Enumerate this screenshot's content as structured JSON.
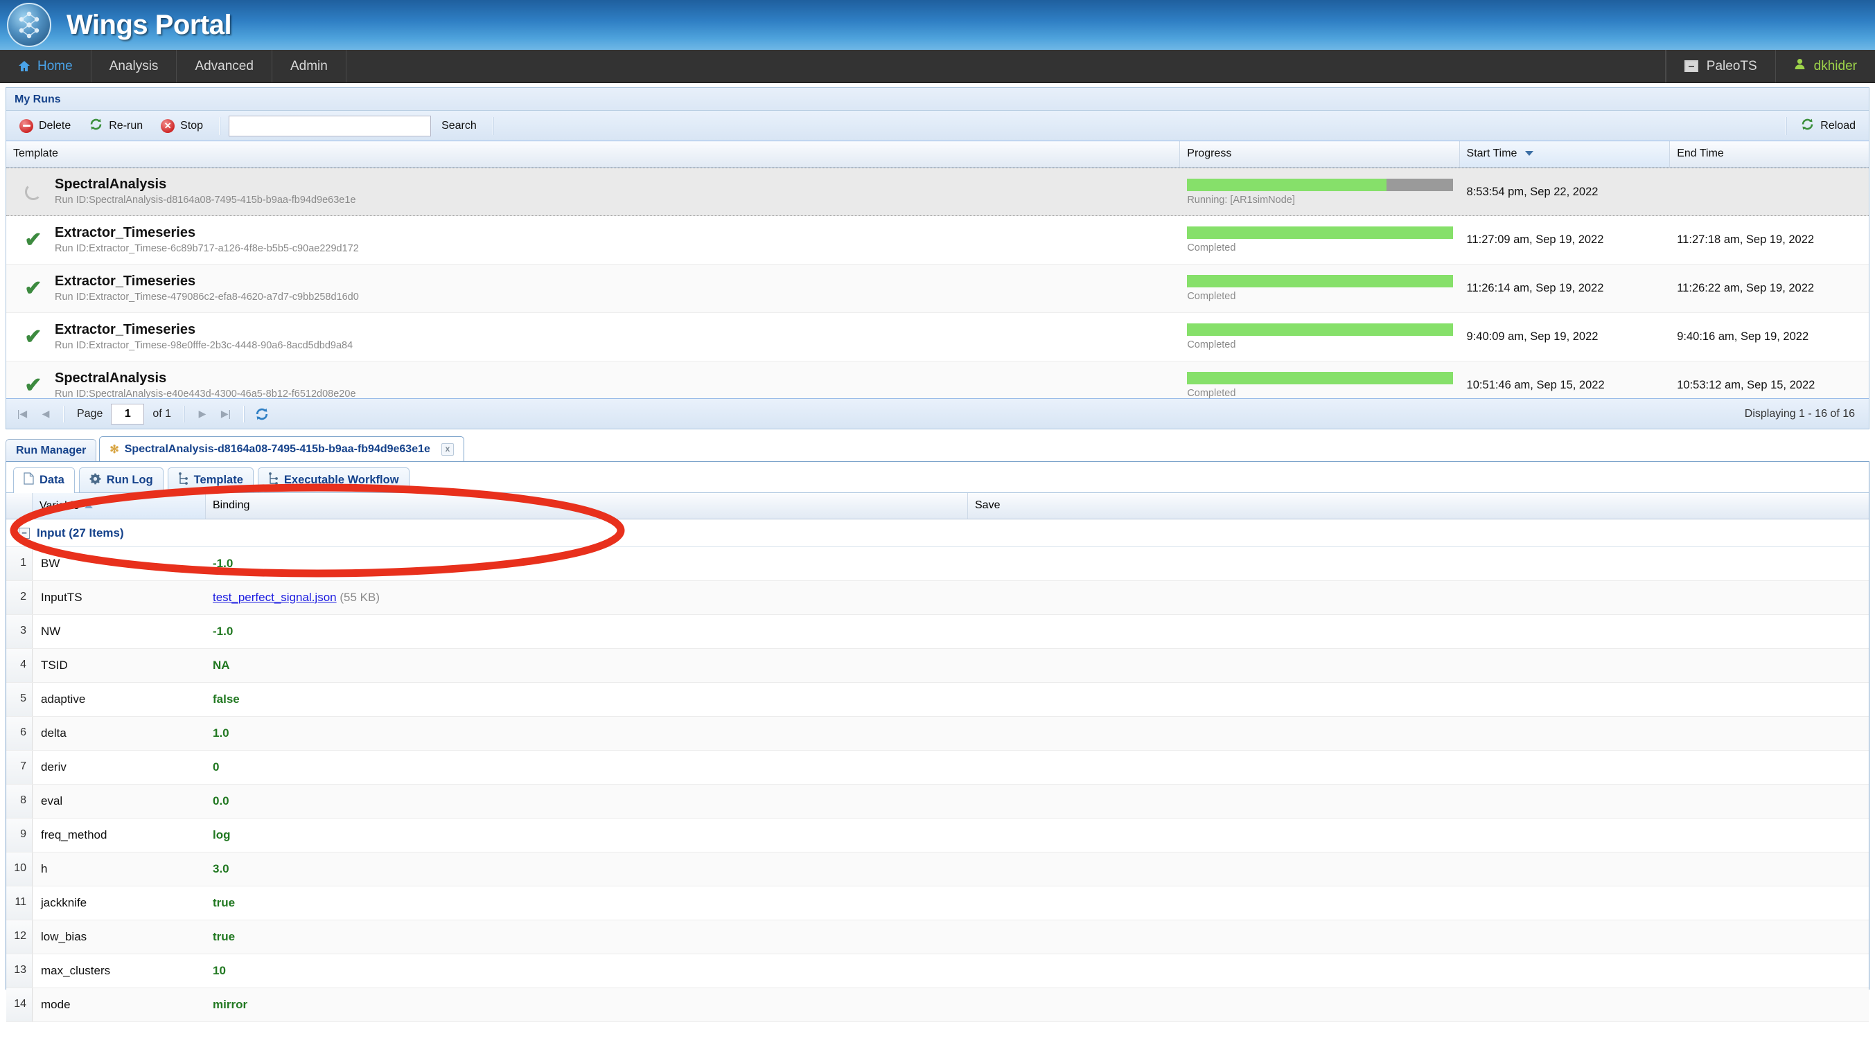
{
  "header": {
    "title": "Wings Portal",
    "logo_icon": "wings-logo-icon"
  },
  "nav": {
    "items": [
      {
        "label": "Home",
        "icon": "home-icon",
        "active": true
      },
      {
        "label": "Analysis",
        "active": false
      },
      {
        "label": "Advanced",
        "active": false
      },
      {
        "label": "Admin",
        "active": false
      }
    ],
    "right": [
      {
        "label": "PaleoTS",
        "icon": "domain-box-icon"
      },
      {
        "label": "dkhider",
        "icon": "user-icon"
      }
    ]
  },
  "my_runs": {
    "panel_title": "My Runs",
    "toolbar": {
      "delete_label": "Delete",
      "rerun_label": "Re-run",
      "stop_label": "Stop",
      "search_value": "",
      "search_placeholder": "",
      "search_label": "Search",
      "reload_label": "Reload"
    },
    "columns": [
      "Template",
      "Progress",
      "Start Time",
      "End Time"
    ],
    "sorted_column": "Start Time",
    "sort_direction": "desc",
    "rows": [
      {
        "template": "SpectralAnalysis",
        "run_id": "Run ID:SpectralAnalysis-d8164a08-7495-415b-b9aa-fb94d9e63e1e",
        "status_icon": "running-spinner-icon",
        "progress_percent": 75,
        "progress_text": "Running: [AR1simNode]",
        "start_time": "8:53:54 pm, Sep 22, 2022",
        "end_time": "",
        "selected": true
      },
      {
        "template": "Extractor_Timeseries",
        "run_id": "Run ID:Extractor_Timese-6c89b717-a126-4f8e-b5b5-c90ae229d172",
        "status_icon": "check-icon",
        "progress_percent": 100,
        "progress_text": "Completed",
        "start_time": "11:27:09 am, Sep 19, 2022",
        "end_time": "11:27:18 am, Sep 19, 2022",
        "selected": false
      },
      {
        "template": "Extractor_Timeseries",
        "run_id": "Run ID:Extractor_Timese-479086c2-efa8-4620-a7d7-c9bb258d16d0",
        "status_icon": "check-icon",
        "progress_percent": 100,
        "progress_text": "Completed",
        "start_time": "11:26:14 am, Sep 19, 2022",
        "end_time": "11:26:22 am, Sep 19, 2022",
        "selected": false
      },
      {
        "template": "Extractor_Timeseries",
        "run_id": "Run ID:Extractor_Timese-98e0fffe-2b3c-4448-90a6-8acd5dbd9a84",
        "status_icon": "check-icon",
        "progress_percent": 100,
        "progress_text": "Completed",
        "start_time": "9:40:09 am, Sep 19, 2022",
        "end_time": "9:40:16 am, Sep 19, 2022",
        "selected": false
      },
      {
        "template": "SpectralAnalysis",
        "run_id": "Run ID:SpectralAnalysis-e40e443d-4300-46a5-8b12-f6512d08e20e",
        "status_icon": "check-icon",
        "progress_percent": 100,
        "progress_text": "Completed",
        "start_time": "10:51:46 am, Sep 15, 2022",
        "end_time": "10:53:12 am, Sep 15, 2022",
        "selected": false
      }
    ],
    "paging": {
      "first_icon": "first-page-icon",
      "prev_icon": "prev-page-icon",
      "page_label": "Page",
      "page_value": "1",
      "of_label": "of 1",
      "next_icon": "next-page-icon",
      "last_icon": "last-page-icon",
      "refresh_icon": "refresh-icon",
      "display_text": "Displaying 1 - 16 of 16"
    }
  },
  "tabs": {
    "items": [
      {
        "label": "Run Manager",
        "active": false,
        "closable": false
      },
      {
        "label": "SpectralAnalysis-d8164a08-7495-415b-b9aa-fb94d9e63e1e",
        "active": true,
        "closable": true,
        "icon": "star-icon"
      }
    ],
    "close_label": "x"
  },
  "subtabs": {
    "items": [
      {
        "label": "Data",
        "icon": "document-icon",
        "active": true
      },
      {
        "label": "Run Log",
        "icon": "gear-icon",
        "active": false
      },
      {
        "label": "Template",
        "icon": "workflow-icon",
        "active": false
      },
      {
        "label": "Executable Workflow",
        "icon": "workflow-icon",
        "active": false
      }
    ]
  },
  "data_grid": {
    "columns": [
      "Variable",
      "Binding",
      "Save"
    ],
    "sorted_column": "Variable",
    "sort_direction": "asc",
    "group_label": "Input (27 Items)",
    "group_collapsed": false,
    "rows": [
      {
        "num": "1",
        "variable": "BW",
        "binding": "-1.0",
        "type": "value"
      },
      {
        "num": "2",
        "variable": "InputTS",
        "binding": "test_perfect_signal.json",
        "size": "(55 KB)",
        "type": "file"
      },
      {
        "num": "3",
        "variable": "NW",
        "binding": "-1.0",
        "type": "value"
      },
      {
        "num": "4",
        "variable": "TSID",
        "binding": "NA",
        "type": "value"
      },
      {
        "num": "5",
        "variable": "adaptive",
        "binding": "false",
        "type": "value"
      },
      {
        "num": "6",
        "variable": "delta",
        "binding": "1.0",
        "type": "value"
      },
      {
        "num": "7",
        "variable": "deriv",
        "binding": "0",
        "type": "value"
      },
      {
        "num": "8",
        "variable": "eval",
        "binding": "0.0",
        "type": "value"
      },
      {
        "num": "9",
        "variable": "freq_method",
        "binding": "log",
        "type": "value"
      },
      {
        "num": "10",
        "variable": "h",
        "binding": "3.0",
        "type": "value"
      },
      {
        "num": "11",
        "variable": "jackknife",
        "binding": "true",
        "type": "value"
      },
      {
        "num": "12",
        "variable": "low_bias",
        "binding": "true",
        "type": "value"
      },
      {
        "num": "13",
        "variable": "max_clusters",
        "binding": "10",
        "type": "value"
      },
      {
        "num": "14",
        "variable": "mode",
        "binding": "mirror",
        "type": "value"
      }
    ]
  },
  "annotation": {
    "shape": "ellipse",
    "color": "#e8301c"
  }
}
